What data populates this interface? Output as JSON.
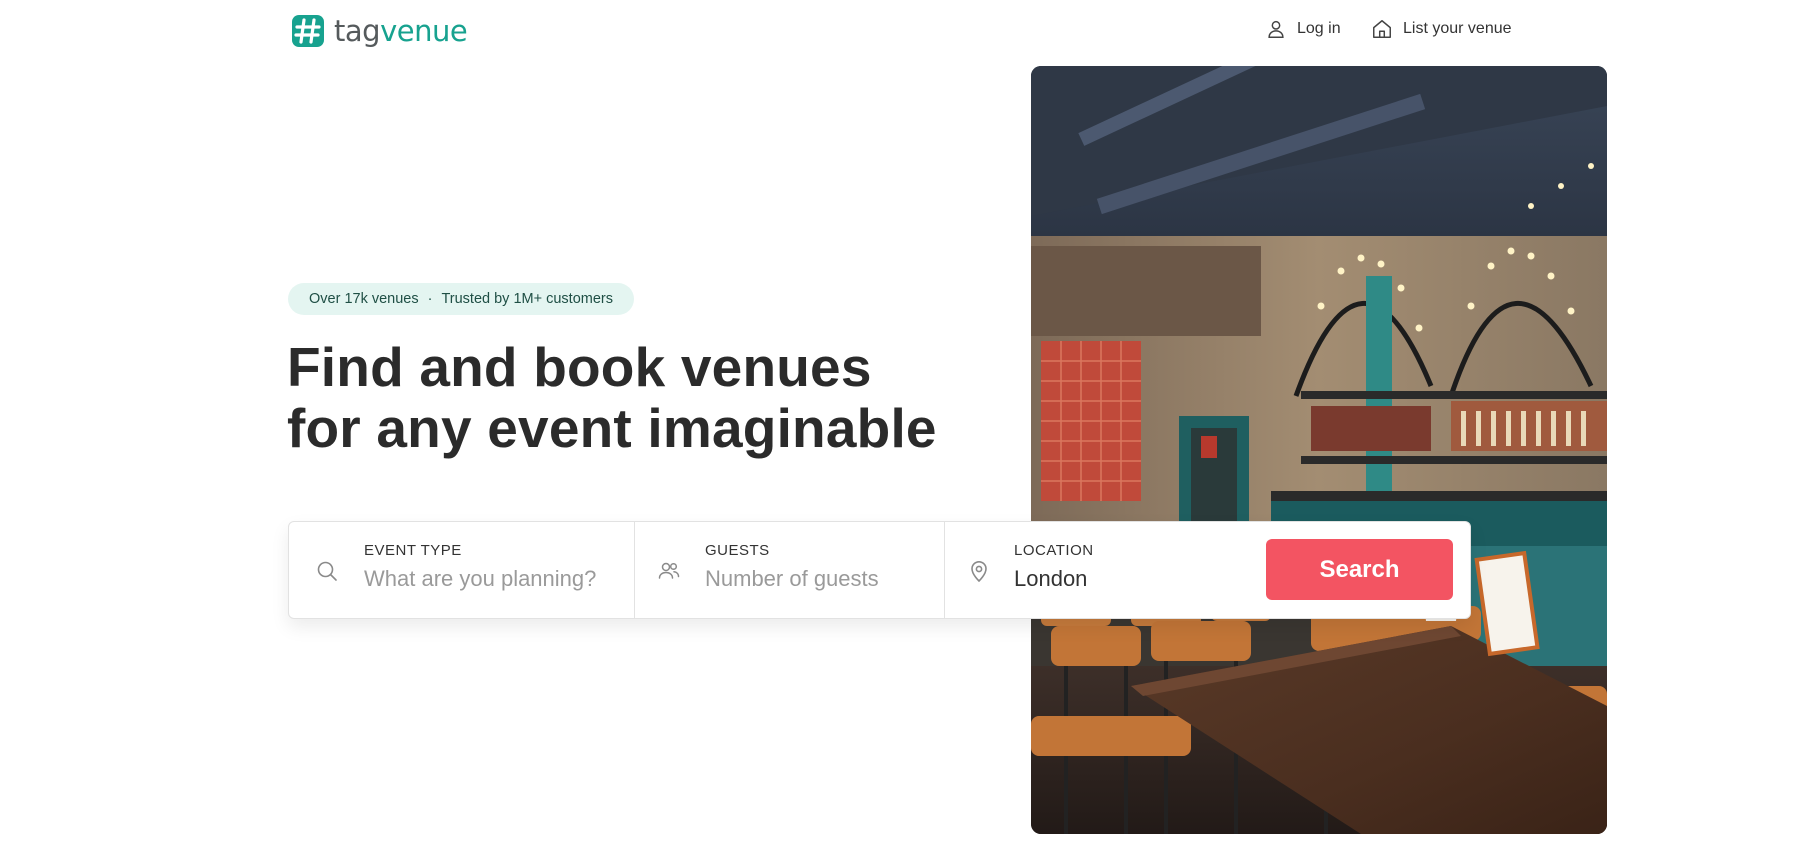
{
  "header": {
    "logo": {
      "part1": "tag",
      "part2": "venue",
      "mark_icon": "hash-logo-icon"
    },
    "nav": [
      {
        "label": "Log in",
        "icon": "user-icon"
      },
      {
        "label": "List your venue",
        "icon": "house-icon"
      }
    ]
  },
  "hero": {
    "badge": {
      "venues": "Over 17k venues",
      "separator": "·",
      "trust": "Trusted by 1M+ customers"
    },
    "headline": {
      "line1": "Find and book venues",
      "line2": "for any event imaginable"
    }
  },
  "search": {
    "event_type": {
      "label": "EVENT TYPE",
      "placeholder": "What are you planning?",
      "value": "",
      "icon": "search-icon"
    },
    "guests": {
      "label": "GUESTS",
      "placeholder": "Number of guests",
      "value": "",
      "icon": "guests-icon"
    },
    "location": {
      "label": "LOCATION",
      "value": "London",
      "icon": "location-pin-icon"
    },
    "button_label": "Search"
  },
  "colors": {
    "brand_teal": "#17a28f",
    "search_button": "#f35462",
    "badge_bg": "#e4f5f1"
  }
}
